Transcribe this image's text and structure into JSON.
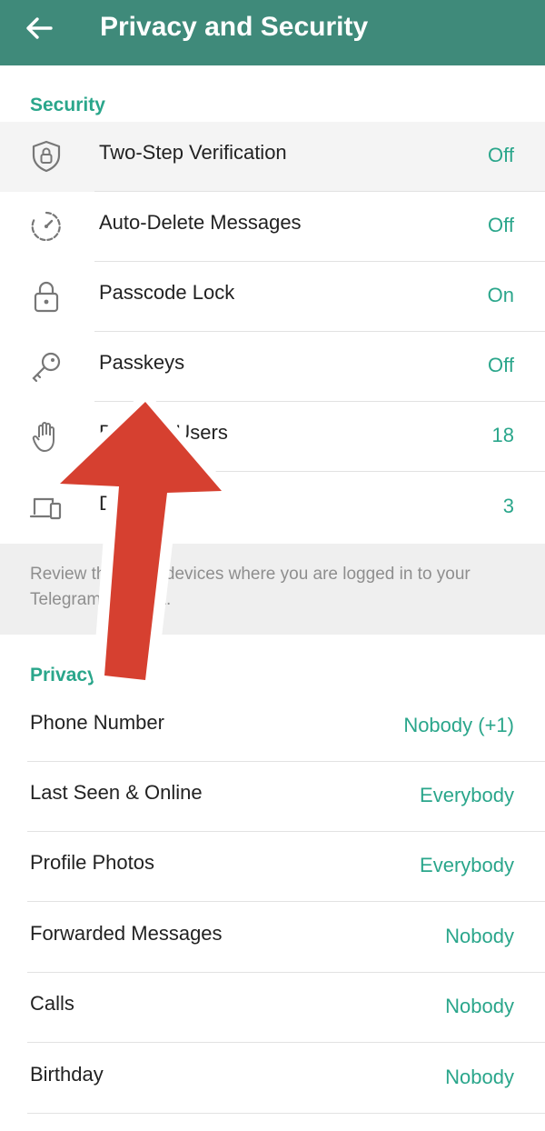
{
  "header": {
    "title": "Privacy and Security"
  },
  "security": {
    "heading": "Security",
    "items": [
      {
        "label": "Two-Step Verification",
        "value": "Off"
      },
      {
        "label": "Auto-Delete Messages",
        "value": "Off"
      },
      {
        "label": "Passcode Lock",
        "value": "On"
      },
      {
        "label": "Passkeys",
        "value": "Off"
      },
      {
        "label": "Blocked Users",
        "value": "18"
      },
      {
        "label": "Devices",
        "value": "3"
      }
    ],
    "info": "Review the list of devices where you are logged in to your Telegram account."
  },
  "privacy": {
    "heading": "Privacy",
    "items": [
      {
        "label": "Phone Number",
        "value": "Nobody (+1)"
      },
      {
        "label": "Last Seen & Online",
        "value": "Everybody"
      },
      {
        "label": "Profile Photos",
        "value": "Everybody"
      },
      {
        "label": "Forwarded Messages",
        "value": "Nobody"
      },
      {
        "label": "Calls",
        "value": "Nobody"
      },
      {
        "label": "Birthday",
        "value": "Nobody"
      }
    ]
  },
  "icons": [
    "back-arrow-icon",
    "shield-lock-icon",
    "timer-icon",
    "padlock-icon",
    "key-icon",
    "hand-icon",
    "devices-icon",
    "red-arrow-overlay-icon"
  ],
  "colors": {
    "appbar": "#3f8a7a",
    "accent": "#2aa68b",
    "overlay_arrow": "#d64030"
  }
}
